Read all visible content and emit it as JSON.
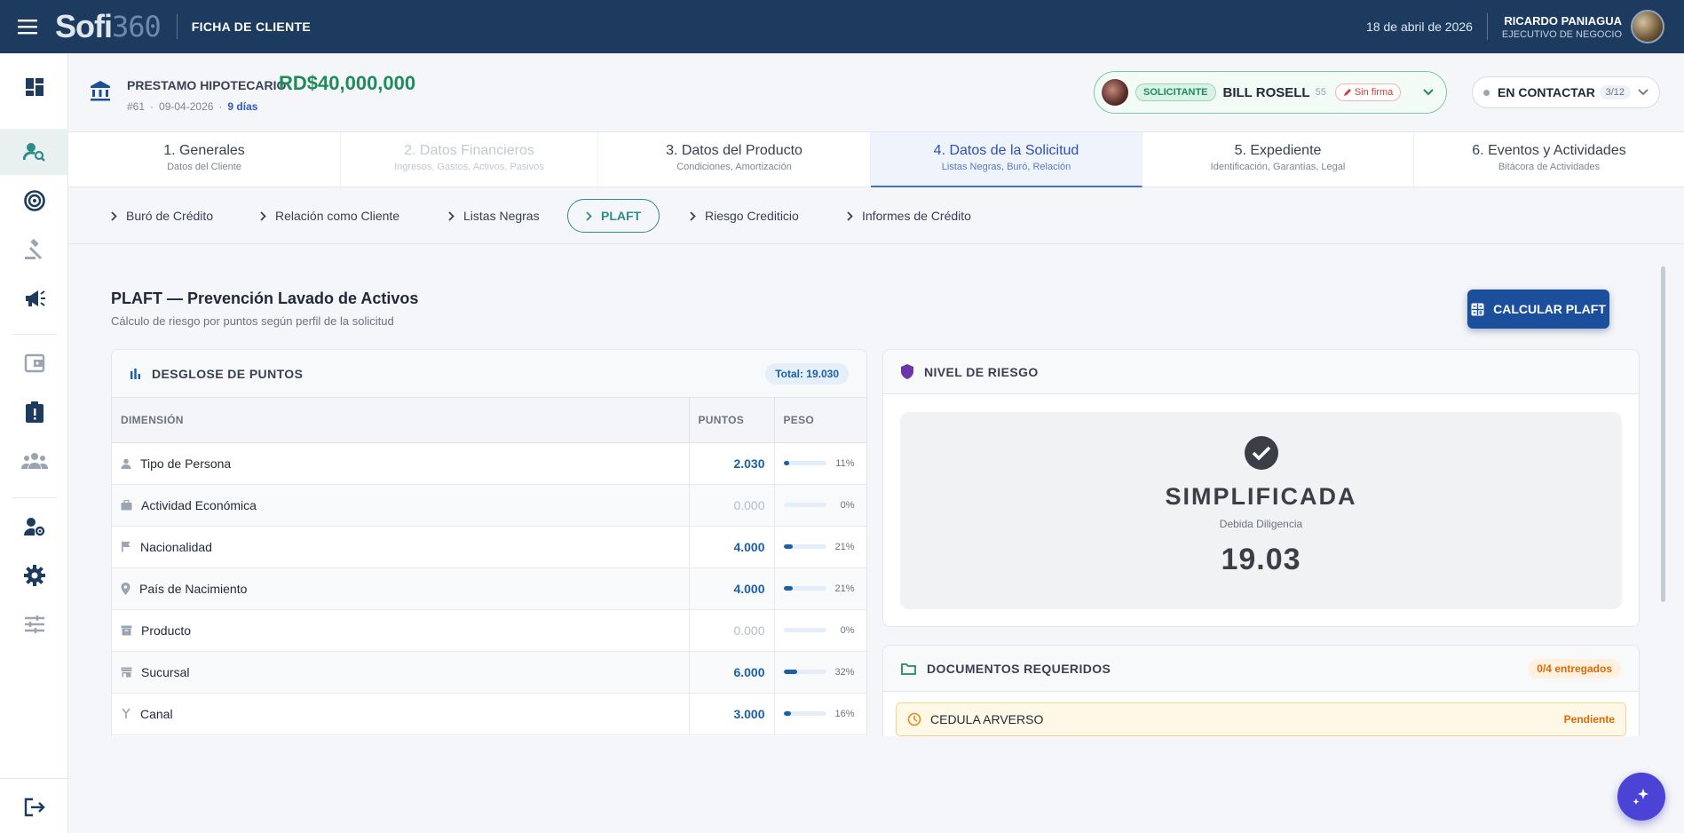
{
  "topbar": {
    "logo_main": "Sofi",
    "logo_num": "360",
    "page_label": "FICHA DE CLIENTE",
    "date": "18 de abril de 2026",
    "user_name": "RICARDO PANIAGUA",
    "user_role": "EJECUTIVO DE NEGOCIO"
  },
  "loan": {
    "type": "PRESTAMO HIPOTECARIO",
    "amount": "RD$40,000,000",
    "id": "#61",
    "sep": "·",
    "date": "09-04-2026",
    "days": "9 días"
  },
  "applicant": {
    "role": "SOLICITANTE",
    "name": "BILL ROSELL",
    "age": "55",
    "signature": "Sin firma"
  },
  "status": {
    "label": "EN CONTACTAR",
    "count": "3/12"
  },
  "steps": [
    {
      "title": "1. Generales",
      "sub": "Datos del Cliente"
    },
    {
      "title": "2. Datos Financieros",
      "sub": "Ingresos, Gastos, Activos, Pasivos"
    },
    {
      "title": "3. Datos del Producto",
      "sub": "Condiciones, Amortización"
    },
    {
      "title": "4. Datos de la Solicitud",
      "sub": "Listas Negras, Buró, Relación"
    },
    {
      "title": "5. Expediente",
      "sub": "Identificación, Garantías, Legal"
    },
    {
      "title": "6. Eventos y Actividades",
      "sub": "Bitácora de Actividades"
    }
  ],
  "subtabs": [
    "Buró de Crédito",
    "Relación como Cliente",
    "Listas Negras",
    "PLAFT",
    "Riesgo Crediticio",
    "Informes de Crédito"
  ],
  "section": {
    "title": "PLAFT — Prevención Lavado de Activos",
    "subtitle": "Cálculo de riesgo por puntos según perfil de la solicitud",
    "calc_button": "CALCULAR PLAFT"
  },
  "breakdown": {
    "title": "DESGLOSE DE PUNTOS",
    "total": "Total: 19.030",
    "headers": [
      "DIMENSIÓN",
      "PUNTOS",
      "PESO"
    ],
    "rows": [
      {
        "name": "Tipo de Persona",
        "points": "2.030",
        "pct": "11%",
        "weight": 0.11
      },
      {
        "name": "Actividad Económica",
        "points": "0.000",
        "pct": "0%",
        "weight": 0
      },
      {
        "name": "Nacionalidad",
        "points": "4.000",
        "pct": "21%",
        "weight": 0.21
      },
      {
        "name": "País de Nacimiento",
        "points": "4.000",
        "pct": "21%",
        "weight": 0.21
      },
      {
        "name": "Producto",
        "points": "0.000",
        "pct": "0%",
        "weight": 0
      },
      {
        "name": "Sucursal",
        "points": "6.000",
        "pct": "32%",
        "weight": 0.32
      },
      {
        "name": "Canal",
        "points": "3.000",
        "pct": "16%",
        "weight": 0.16
      }
    ]
  },
  "risk": {
    "title": "NIVEL DE RIESGO",
    "level": "SIMPLIFICADA",
    "subtitle": "Debida Diligencia",
    "score": "19.03"
  },
  "documents": {
    "title": "DOCUMENTOS REQUERIDOS",
    "delivered": "0/4 entregados",
    "items": [
      {
        "name": "CEDULA ARVERSO",
        "status": "Pendiente"
      }
    ]
  },
  "colors": {
    "topbar": "#1d3a5f",
    "accent_green": "#1f8a5b",
    "accent_blue": "#1b5fa8",
    "teal": "#2e8c8a",
    "fab": "#4b43d6"
  }
}
